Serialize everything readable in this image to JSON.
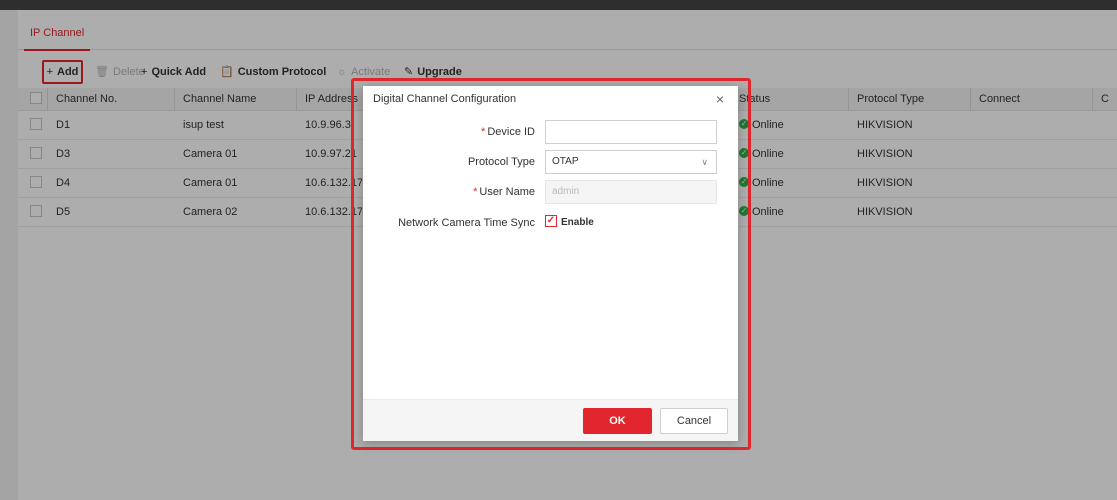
{
  "tabs": [
    {
      "label": "IP Channel"
    }
  ],
  "toolbar": {
    "add": "Add",
    "delete": "Delete",
    "quick_add": "Quick Add",
    "custom_protocol": "Custom Protocol",
    "activate": "Activate",
    "upgrade": "Upgrade"
  },
  "table": {
    "headers": {
      "channel_no": "Channel No.",
      "channel_name": "Channel Name",
      "ip_address": "IP Address",
      "status": "Status",
      "protocol_type": "Protocol Type",
      "connect": "Connect",
      "more": "C"
    },
    "rows": [
      {
        "channel_no": "D1",
        "channel_name": "isup test",
        "ip": "10.9.96.3",
        "status": "Online",
        "protocol": "HIKVISION"
      },
      {
        "channel_no": "D3",
        "channel_name": "Camera 01",
        "ip": "10.9.97.21",
        "status": "Online",
        "protocol": "HIKVISION"
      },
      {
        "channel_no": "D4",
        "channel_name": "Camera 01",
        "ip": "10.6.132.17",
        "status": "Online",
        "protocol": "HIKVISION"
      },
      {
        "channel_no": "D5",
        "channel_name": "Camera 02",
        "ip": "10.6.132.17",
        "status": "Online",
        "protocol": "HIKVISION"
      }
    ]
  },
  "dialog": {
    "title": "Digital Channel Configuration",
    "close": "×",
    "required_mark": "*",
    "fields": {
      "device_id": {
        "label": "Device ID",
        "value": ""
      },
      "protocol_type": {
        "label": "Protocol Type",
        "value": "OTAP"
      },
      "user_name": {
        "label": "User Name",
        "value": "admin"
      },
      "time_sync": {
        "label": "Network Camera Time Sync",
        "option": "Enable",
        "checked": true
      }
    },
    "ok": "OK",
    "cancel": "Cancel"
  },
  "colors": {
    "accent": "#e1272d",
    "online": "#2eb34a"
  },
  "icons": {
    "add": "plus-icon",
    "delete": "trash-icon",
    "quick_add": "plus-icon",
    "custom_protocol": "clipboard-icon",
    "activate": "sun-icon",
    "upgrade": "pencil-icon",
    "status": "check-circle-icon",
    "close": "close-icon",
    "select": "chevron-down-icon"
  }
}
